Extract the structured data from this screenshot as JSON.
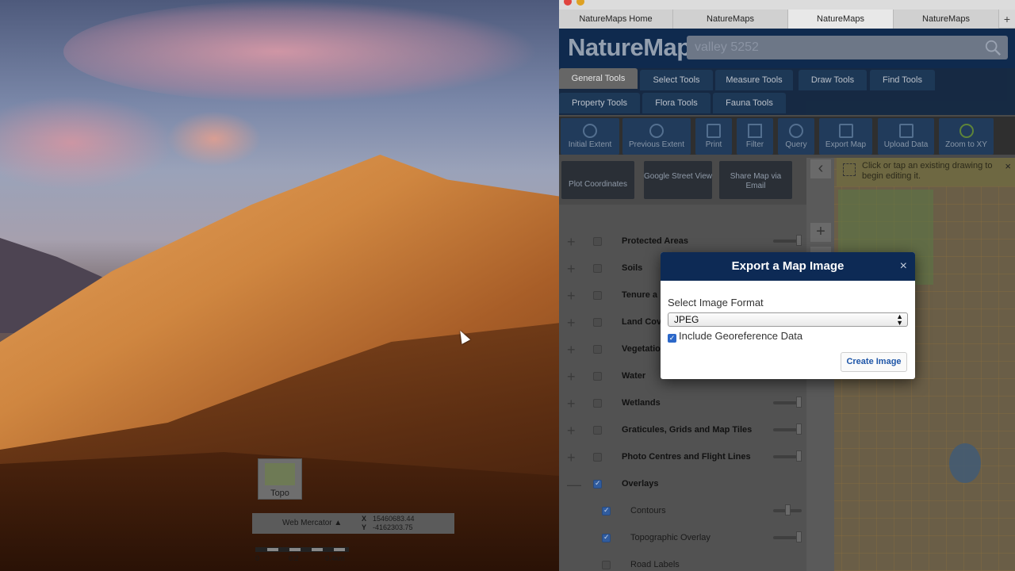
{
  "browser": {
    "tabs": [
      {
        "label": "NatureMaps Home"
      },
      {
        "label": "NatureMaps"
      },
      {
        "label": "NatureMaps"
      },
      {
        "label": "NatureMaps"
      }
    ],
    "new_tab": "+"
  },
  "app": {
    "logo": "NatureMaps",
    "search_value": "valley 5252",
    "toolbar_tabs": {
      "general": "General Tools",
      "select": "Select Tools",
      "measure": "Measure Tools",
      "draw": "Draw Tools",
      "find": "Find Tools",
      "property": "Property Tools",
      "flora": "Flora Tools",
      "fauna": "Fauna Tools"
    },
    "tools": {
      "initial_extent": "Initial Extent",
      "previous_extent": "Previous Extent",
      "print": "Print",
      "filter": "Filter",
      "query": "Query",
      "export_map": "Export Map",
      "upload_data": "Upload Data",
      "zoom_xy": "Zoom to XY"
    },
    "second_row": {
      "plot_coordinates": "Plot Coordinates",
      "street_view": "Google Street View",
      "share_map": "Share Map via Email"
    },
    "layers": [
      {
        "name": "Protected Areas",
        "checked": false
      },
      {
        "name": "Soils",
        "checked": false
      },
      {
        "name": "Tenure a",
        "checked": false
      },
      {
        "name": "Land Cov",
        "checked": false
      },
      {
        "name": "Vegetatio",
        "checked": false
      },
      {
        "name": "Water",
        "checked": false
      },
      {
        "name": "Wetlands",
        "checked": false
      },
      {
        "name": "Graticules, Grids and Map Tiles",
        "checked": false
      },
      {
        "name": "Photo Centres and Flight Lines",
        "checked": false
      },
      {
        "name": "Overlays",
        "checked": true,
        "expand": "—"
      },
      {
        "name": "Contours",
        "checked": true
      },
      {
        "name": "Topographic Overlay",
        "checked": true
      },
      {
        "name": "Road Labels",
        "checked": false
      }
    ],
    "map": {
      "edit_hint": "Click or tap an existing drawing to begin editing it.",
      "basemap": "Topo",
      "projection": "Web Mercator ▲",
      "x_label": "X",
      "y_label": "Y",
      "x_value": "15460683.44",
      "y_value": "-4162303.75",
      "scale": [
        "0",
        "0.2",
        "0.4km"
      ]
    }
  },
  "modal": {
    "title": "Export a Map Image",
    "close": "×",
    "format_label": "Select Image Format",
    "format_value": "JPEG",
    "georef_label": "Include Georeference Data",
    "georef_checked": true,
    "create_button": "Create Image"
  }
}
